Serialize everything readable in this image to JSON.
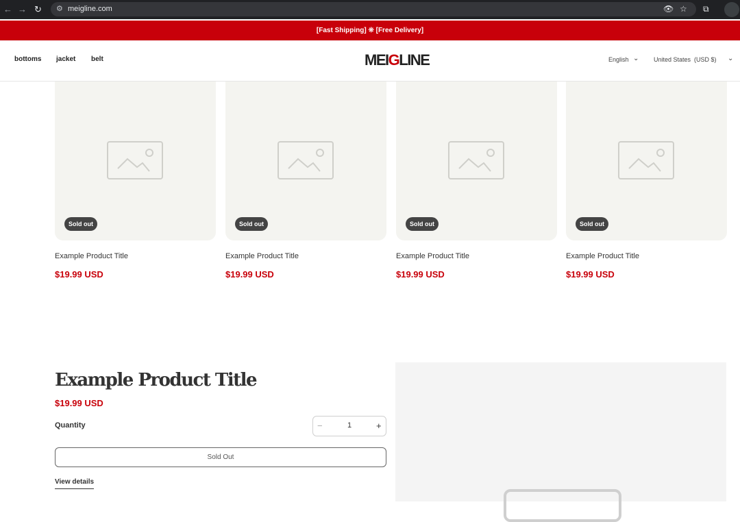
{
  "browser": {
    "url": "meigline.com"
  },
  "announcement": {
    "text": "[Fast Shipping] ❊ [Free Delivery]"
  },
  "header": {
    "nav": [
      "bottoms",
      "jacket",
      "belt"
    ],
    "logo_left": "MEI",
    "logo_red": "G",
    "logo_right": "LINE",
    "language": "English",
    "country": "United States",
    "currency": "(USD $)"
  },
  "products": [
    {
      "badge": "Sold out",
      "title": "Example Product Title",
      "price": "$19.99 USD"
    },
    {
      "badge": "Sold out",
      "title": "Example Product Title",
      "price": "$19.99 USD"
    },
    {
      "badge": "Sold out",
      "title": "Example Product Title",
      "price": "$19.99 USD"
    },
    {
      "badge": "Sold out",
      "title": "Example Product Title",
      "price": "$19.99 USD"
    }
  ],
  "featured": {
    "title": "Example Product Title",
    "price": "$19.99 USD",
    "quantity_label": "Quantity",
    "quantity_value": "1",
    "minus": "−",
    "plus": "+",
    "button_label": "Sold Out",
    "details_link": "View details"
  },
  "colors": {
    "brand_red": "#c8000a",
    "badge": "#444444",
    "placeholder_bg": "#f4f4f0"
  }
}
